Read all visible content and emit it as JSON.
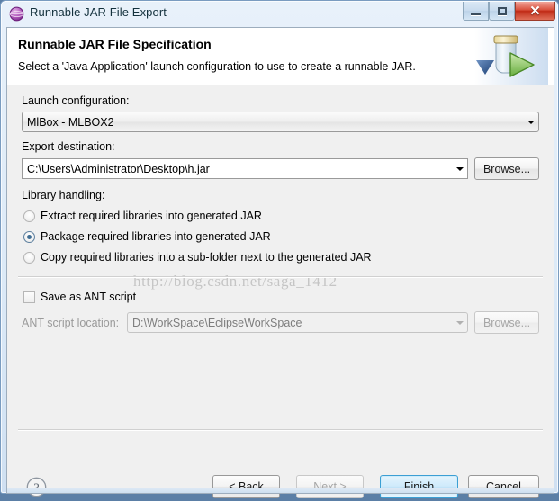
{
  "window": {
    "title": "Runnable JAR File Export",
    "icon": "globe-icon",
    "controls": {
      "minimize": "Minimize",
      "maximize": "Restore",
      "close": "Close",
      "close_glyph": "✕"
    }
  },
  "banner": {
    "title": "Runnable JAR File Specification",
    "description": "Select a 'Java Application' launch configuration to use to create a runnable JAR.",
    "icon": "jar-export-icon"
  },
  "form": {
    "launch_configuration": {
      "label": "Launch configuration:",
      "value": "MlBox - MLBOX2"
    },
    "export_destination": {
      "label": "Export destination:",
      "value": "C:\\Users\\Administrator\\Desktop\\h.jar",
      "browse_label": "Browse..."
    },
    "library_handling": {
      "label": "Library handling:",
      "options": [
        {
          "label": "Extract required libraries into generated JAR",
          "selected": false
        },
        {
          "label": "Package required libraries into generated JAR",
          "selected": true
        },
        {
          "label": "Copy required libraries into a sub-folder next to the generated JAR",
          "selected": false
        }
      ]
    },
    "ant": {
      "save_label": "Save as ANT script",
      "save_checked": false,
      "location_label": "ANT script location:",
      "location_value": "D:\\WorkSpace\\EclipseWorkSpace",
      "browse_label": "Browse...",
      "disabled": true
    }
  },
  "footer": {
    "help_icon": "help-question-icon",
    "buttons": [
      {
        "label": "< Back",
        "state": "enabled"
      },
      {
        "label": "Next >",
        "state": "disabled"
      },
      {
        "label": "Finish",
        "state": "default"
      },
      {
        "label": "Cancel",
        "state": "enabled"
      }
    ]
  },
  "watermark": {
    "text": "http://blog.csdn.net/saga_1412"
  },
  "colors": {
    "accent": "#3c9fd4",
    "close_button": "#c02b16",
    "radio_dot": "#3f6d93",
    "titlebar_text": "#14313d"
  }
}
